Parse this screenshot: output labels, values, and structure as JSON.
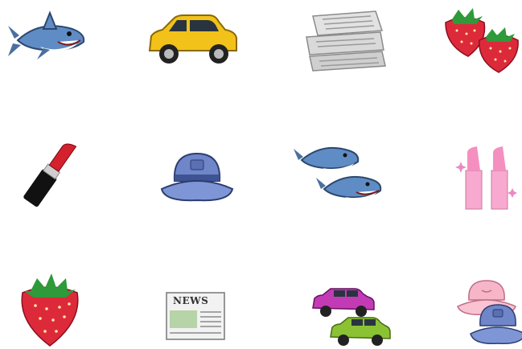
{
  "grid": {
    "rows": 3,
    "columns": 4,
    "items": [
      {
        "row": 1,
        "col": 1,
        "object": "shark",
        "count": 1
      },
      {
        "row": 1,
        "col": 2,
        "object": "car",
        "count": 1,
        "color": "#f2c21a"
      },
      {
        "row": 1,
        "col": 3,
        "object": "newspaper",
        "count": 1
      },
      {
        "row": 1,
        "col": 4,
        "object": "strawberry",
        "count": 2
      },
      {
        "row": 2,
        "col": 1,
        "object": "lipstick",
        "count": 1
      },
      {
        "row": 2,
        "col": 2,
        "object": "bucket-hat",
        "count": 1,
        "color": "#6f86c8"
      },
      {
        "row": 2,
        "col": 3,
        "object": "shark",
        "count": 2
      },
      {
        "row": 2,
        "col": 4,
        "object": "lipstick",
        "count": 2,
        "color": "#f7a9cf"
      },
      {
        "row": 3,
        "col": 1,
        "object": "strawberry",
        "count": 1
      },
      {
        "row": 3,
        "col": 2,
        "object": "newspaper",
        "count": 1,
        "printed_text": "NEWS"
      },
      {
        "row": 3,
        "col": 3,
        "object": "car",
        "count": 2,
        "colors": [
          "#c23bb5",
          "#8ac234"
        ]
      },
      {
        "row": 3,
        "col": 4,
        "object": "bucket-hat",
        "count": 2,
        "colors": [
          "#f7b6c8",
          "#6f86c8"
        ]
      }
    ]
  }
}
